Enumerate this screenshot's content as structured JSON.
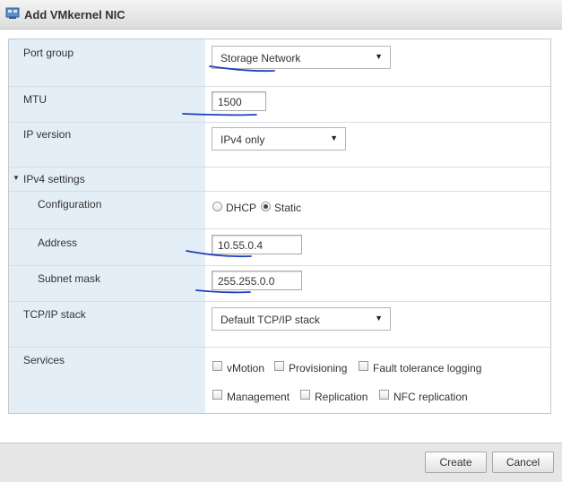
{
  "window": {
    "title": "Add VMkernel NIC",
    "icon": "network-adapter-icon"
  },
  "form": {
    "port_group": {
      "label": "Port group",
      "value": "Storage Network"
    },
    "mtu": {
      "label": "MTU",
      "value": "1500"
    },
    "ip_version": {
      "label": "IP version",
      "value": "IPv4 only"
    },
    "ipv4_settings": {
      "label": "IPv4 settings",
      "configuration": {
        "label": "Configuration",
        "options": [
          "DHCP",
          "Static"
        ],
        "selected": "Static"
      },
      "address": {
        "label": "Address",
        "value": "10.55.0.4"
      },
      "subnet_mask": {
        "label": "Subnet mask",
        "value": "255.255.0.0"
      }
    },
    "tcpip_stack": {
      "label": "TCP/IP stack",
      "value": "Default TCP/IP stack"
    },
    "services": {
      "label": "Services",
      "items": [
        {
          "label": "vMotion",
          "checked": false
        },
        {
          "label": "Provisioning",
          "checked": false
        },
        {
          "label": "Fault tolerance logging",
          "checked": false
        },
        {
          "label": "Management",
          "checked": false
        },
        {
          "label": "Replication",
          "checked": false
        },
        {
          "label": "NFC replication",
          "checked": false
        }
      ]
    }
  },
  "buttons": {
    "create": "Create",
    "cancel": "Cancel"
  },
  "colors": {
    "label_column": "#e4eef7",
    "annotation_ink": "#1f3fbf",
    "footer": "#e6e6e6"
  }
}
